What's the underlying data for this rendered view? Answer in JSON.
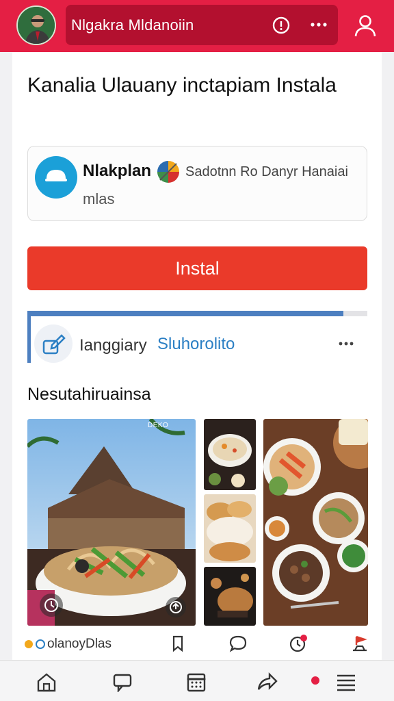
{
  "header": {
    "title": "Nlgakra Mldanoiin",
    "avatar_icon": "user-photo",
    "info_icon": "info-icon",
    "more_icon": "more-icon",
    "profile_icon": "user-icon",
    "accent_color": "#e41f44"
  },
  "card": {
    "headline": "Kanalia Ulauany inctapiam Instala",
    "app": {
      "name": "Nlakplan",
      "developer": "Sadotnn Ro Danyr Hanaiai",
      "subtitle": "mlas",
      "logo_icon": "app-logo-icon",
      "badge_icon": "colorful-badge-icon"
    },
    "install_label": "Instal",
    "install_color": "#ea3a2a",
    "status": {
      "progress": 0.93,
      "label": "Ianggiary",
      "link": "Sluhorolito",
      "icon": "edit-icon"
    },
    "section_title": "Nesutahiruainsa",
    "gallery": {
      "caption": "DEKO",
      "photos": [
        "noodle-salad-photo",
        "soup-bowl-photo",
        "bread-photo",
        "grill-photo",
        "dishes-table-photo"
      ]
    },
    "actions": {
      "source_label": "olanoyDlas",
      "icons": [
        "bookmark-icon",
        "comment-icon",
        "clock-icon",
        "flag-icon"
      ]
    }
  },
  "nav": {
    "items": [
      "home-icon",
      "chat-icon",
      "calendar-icon",
      "share-icon",
      "menu-icon"
    ],
    "active_dot_color": "#e41f44"
  }
}
